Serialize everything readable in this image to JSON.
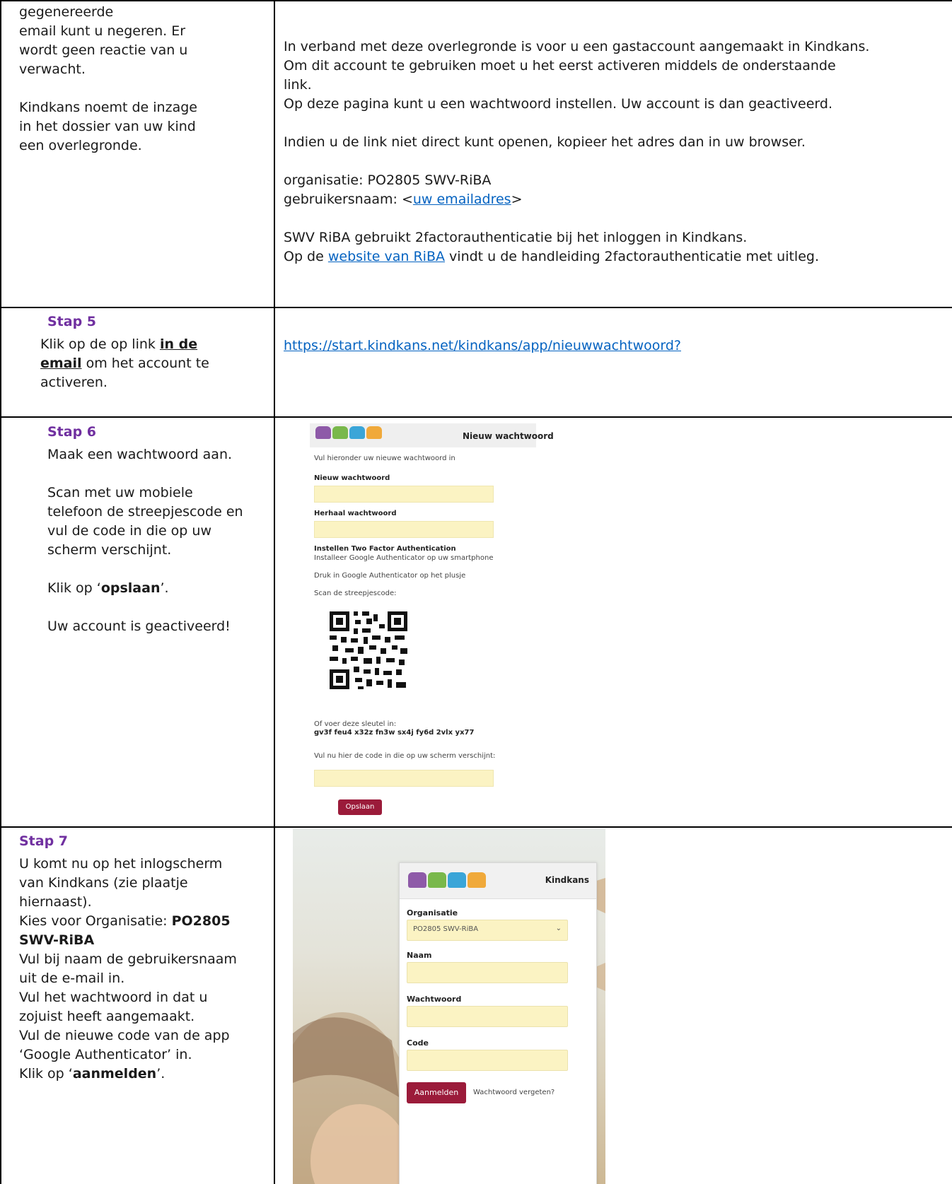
{
  "row_intro": {
    "left": [
      "gegenereerde",
      "email kunt u negeren. Er",
      "wordt geen reactie van u",
      "verwacht.",
      "",
      "Kindkans noemt de inzage",
      "in het dossier van uw kind",
      "een overlegronde."
    ],
    "right": {
      "p1": "In verband met deze overlegronde is voor u een gastaccount aangemaakt in Kindkans.",
      "p2": "Om dit account te gebruiken moet u het eerst activeren middels de onderstaande",
      "p3": "link.",
      "p4": "Op deze pagina kunt u een wachtwoord instellen. Uw account is dan geactiveerd.",
      "p5": "Indien u de link niet direct kunt openen, kopieer het adres dan in uw browser.",
      "org": "organisatie: PO2805 SWV-RiBA",
      "user_prefix": "gebruikersnaam: <",
      "user_link": "uw emailadres",
      "user_suffix": ">",
      "p6": "SWV RiBA gebruikt 2factorauthenticatie bij het inloggen in Kindkans.",
      "p7_prefix": "Op de ",
      "p7_link": "website van RiBA",
      "p7_suffix": " vindt u de handleiding 2factorauthenticatie met uitleg."
    }
  },
  "step5": {
    "title": "Stap 5",
    "text_prefix": "Klik op de op link ",
    "text_bold1": "in de",
    "text_bold2": "email",
    "text_suffix1": " om het  account te",
    "text_suffix2": "activeren.",
    "link": "https://start.kindkans.net/kindkans/app/nieuwwachtwoord?"
  },
  "step6": {
    "title": "Stap 6",
    "l1": "Maak een wachtwoord aan.",
    "l2": "Scan met uw mobiele",
    "l3": "telefoon de streepjescode en",
    "l4": "vul de code in die op uw",
    "l5": "scherm verschijnt.",
    "l6_prefix": "Klik op ‘",
    "l6_bold": "opslaan",
    "l6_suffix": "’.",
    "l7": "Uw account is geactiveerd!",
    "shot": {
      "header": "Nieuw wachtwoord",
      "intro": "Vul hieronder uw nieuwe wachtwoord in",
      "label_new": "Nieuw wachtwoord",
      "label_repeat": "Herhaal wachtwoord",
      "label_2fa": "Instellen Two Factor Authentication",
      "install": "Installeer Google Authenticator op uw smartphone",
      "press": "Druk in Google Authenticator op het plusje",
      "scan": "Scan de streepjescode:",
      "or_key": "Of voer deze sleutel in:",
      "key": "gv3f feu4 x32z fn3w sx4j fy6d 2vlx yx77",
      "enter_code": "Vul nu hier de code in die op uw scherm verschijnt:",
      "save_button": "Opslaan"
    }
  },
  "step7": {
    "title": "Stap 7",
    "l1": "U komt nu op het inlogscherm",
    "l2": "van Kindkans (zie plaatje",
    "l3": "hiernaast).",
    "l4_prefix": "Kies voor Organisatie: ",
    "l4_bold": "PO2805",
    "l5_bold": "SWV-RiBA",
    "l6": "Vul bij naam de gebruikersnaam",
    "l7": "uit de e-mail in.",
    "l8": "Vul het wachtwoord in dat u",
    "l9": "zojuist heeft aangemaakt.",
    "l10": "Vul de nieuwe code van de app",
    "l11": "‘Google Authenticator’ in.",
    "l12_prefix": "Klik op ‘",
    "l12_bold": "aanmelden",
    "l12_suffix": "’.",
    "login": {
      "header": "Kindkans",
      "label_org": "Organisatie",
      "org_value": "PO2805 SWV-RiBA",
      "label_name": "Naam",
      "label_password": "Wachtwoord",
      "label_code": "Code",
      "login_button": "Aanmelden",
      "forgot": "Wachtwoord vergeten?"
    }
  },
  "colors": {
    "step_title": "#7030a0",
    "link": "#0563c1",
    "button": "#9b1b3a",
    "input_bg": "#fbf3c3"
  }
}
